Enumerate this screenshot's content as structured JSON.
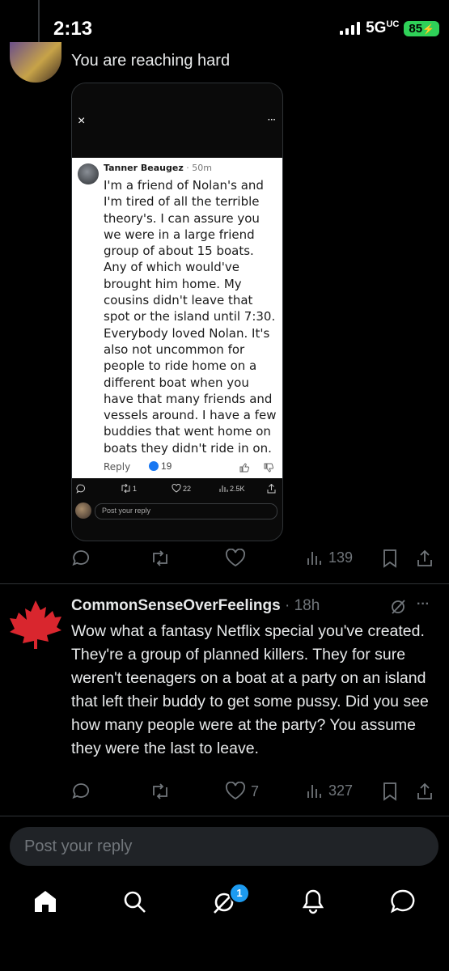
{
  "status_bar": {
    "time": "2:13",
    "network": "5G",
    "network_suffix": "UC",
    "battery": "85"
  },
  "top_reply": {
    "text": "You are reaching hard"
  },
  "embedded_screenshot": {
    "close_symbol": "×",
    "more_symbol": "···",
    "comment": {
      "author": "Tanner Beaugez",
      "time": "· 50m",
      "text": "I'm a friend of Nolan's and I'm tired of all the terrible theory's. I can assure you we were in a large friend group of about 15 boats. Any of which would've brought him home. My cousins didn't leave that spot or the island until 7:30. Everybody loved Nolan. It's also not uncommon for people to ride home on a different boat when you have that many friends and vessels around. I have a few buddies that went home on boats they didn't ride in on.",
      "reply_label": "Reply",
      "reaction_count": "19"
    },
    "stats": {
      "reposts": "1",
      "likes": "22",
      "views": "2.5K"
    },
    "reply_placeholder": "Post your reply"
  },
  "top_reply_actions": {
    "views": "139"
  },
  "comment": {
    "username": "CommonSenseOverFeelings",
    "time": "· 18h",
    "text": "Wow what a fantasy Netflix special you've created. They're a group of planned killers. They for sure weren't teenagers on a boat at a party on an island that left their buddy to get some pussy. Did you see how many people were at the party? You assume they were the last to leave.",
    "likes": "7",
    "views": "327",
    "more_symbol": "···"
  },
  "reply_bar": {
    "placeholder": "Post your reply"
  },
  "bottom_nav": {
    "notification_badge": "1"
  },
  "colors": {
    "background": "#000000",
    "muted": "#71767b",
    "accent": "#1d9bf0",
    "battery": "#2fd158",
    "maple_leaf": "#d9262e"
  }
}
